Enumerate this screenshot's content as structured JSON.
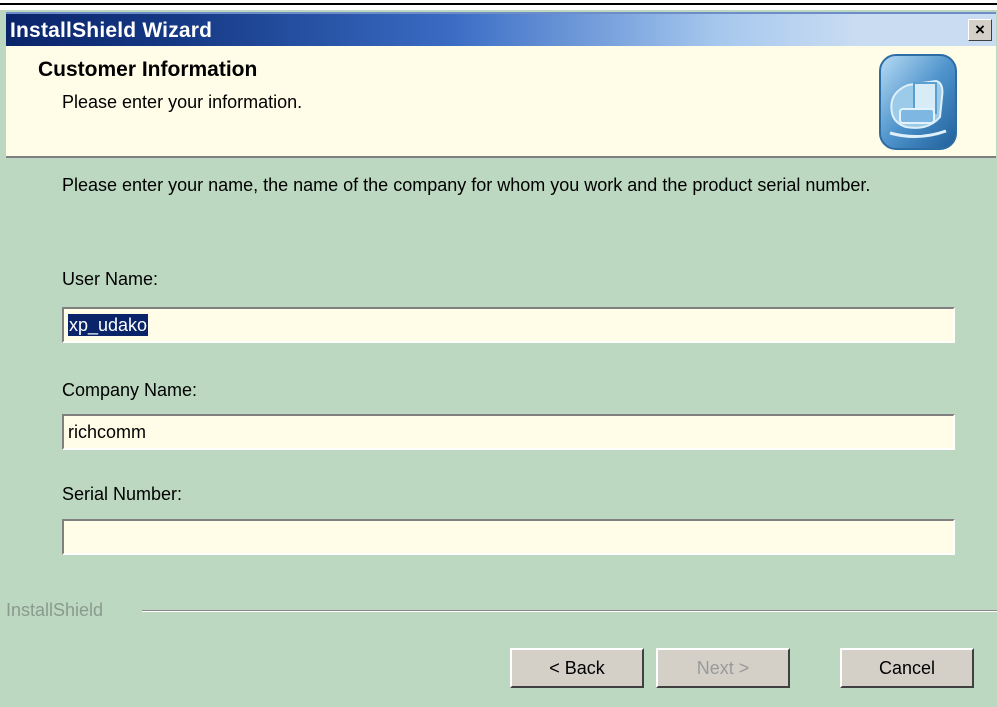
{
  "window": {
    "title": "InstallShield Wizard",
    "close_glyph": "×"
  },
  "header": {
    "title": "Customer Information",
    "subtitle": "Please enter your information.",
    "icon": "computer-setup-icon"
  },
  "instructions": "Please enter your name, the name of the company for whom you work and the product serial number.",
  "fields": {
    "user_name": {
      "label": "User Name:",
      "value": "xp_udako"
    },
    "company_name": {
      "label": "Company Name:",
      "value": "richcomm"
    },
    "serial_number": {
      "label": "Serial Number:",
      "value": ""
    }
  },
  "footer": {
    "brand": "InstallShield",
    "buttons": {
      "back": "< Back",
      "next": "Next >",
      "cancel": "Cancel"
    }
  },
  "colors": {
    "title_bar": "#0a246a",
    "dialog_bg": "#bcd8c0",
    "header_bg": "#fffde8",
    "selection": "#0a246a"
  }
}
